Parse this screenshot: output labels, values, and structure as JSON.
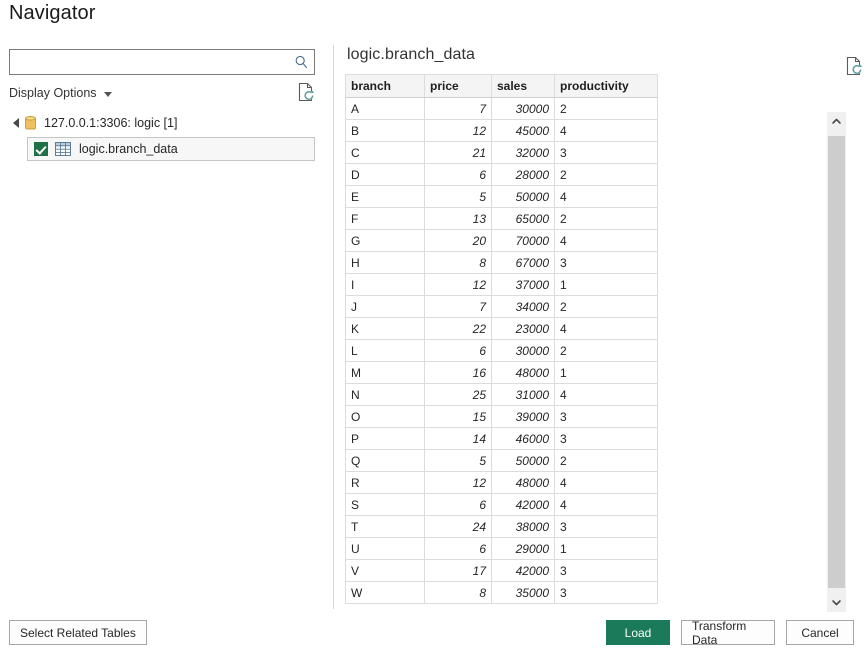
{
  "window": {
    "title": "Navigator"
  },
  "left_pane": {
    "search": {
      "value": "",
      "placeholder": "",
      "icon": "search-icon"
    },
    "display_options": {
      "label": "Display Options",
      "icon": "chevron-down-icon"
    },
    "refresh_icon": "refresh-document-icon",
    "tree": {
      "server": {
        "label": "127.0.0.1:3306: logic [1]",
        "icon": "database-icon",
        "expanded": true
      },
      "items": [
        {
          "label": "logic.branch_data",
          "checked": true,
          "selected": true,
          "icon": "table-icon"
        }
      ]
    }
  },
  "right_pane": {
    "preview_title": "logic.branch_data",
    "refresh_icon": "refresh-document-icon",
    "table": {
      "columns": [
        "branch",
        "price",
        "sales",
        "productivity"
      ],
      "column_align": [
        "left",
        "right",
        "right",
        "left"
      ],
      "rows": [
        [
          "A",
          "7",
          "30000",
          "2"
        ],
        [
          "B",
          "12",
          "45000",
          "4"
        ],
        [
          "C",
          "21",
          "32000",
          "3"
        ],
        [
          "D",
          "6",
          "28000",
          "2"
        ],
        [
          "E",
          "5",
          "50000",
          "4"
        ],
        [
          "F",
          "13",
          "65000",
          "2"
        ],
        [
          "G",
          "20",
          "70000",
          "4"
        ],
        [
          "H",
          "8",
          "67000",
          "3"
        ],
        [
          "I",
          "12",
          "37000",
          "1"
        ],
        [
          "J",
          "7",
          "34000",
          "2"
        ],
        [
          "K",
          "22",
          "23000",
          "4"
        ],
        [
          "L",
          "6",
          "30000",
          "2"
        ],
        [
          "M",
          "16",
          "48000",
          "1"
        ],
        [
          "N",
          "25",
          "31000",
          "4"
        ],
        [
          "O",
          "15",
          "39000",
          "3"
        ],
        [
          "P",
          "14",
          "46000",
          "3"
        ],
        [
          "Q",
          "5",
          "50000",
          "2"
        ],
        [
          "R",
          "12",
          "48000",
          "4"
        ],
        [
          "S",
          "6",
          "42000",
          "4"
        ],
        [
          "T",
          "24",
          "38000",
          "3"
        ],
        [
          "U",
          "6",
          "29000",
          "1"
        ],
        [
          "V",
          "17",
          "42000",
          "3"
        ],
        [
          "W",
          "8",
          "35000",
          "3"
        ]
      ]
    }
  },
  "scrollbar": {
    "up_icon": "chevron-up-icon",
    "down_icon": "chevron-down-icon"
  },
  "footer": {
    "select_related_tables": "Select Related Tables",
    "load": "Load",
    "transform_data": "Transform Data",
    "cancel": "Cancel"
  },
  "colors": {
    "accent_green": "#1a7a59",
    "checkbox_green": "#1e7145",
    "header_bg": "#f4f4f4",
    "grid_line": "#dcdcdc",
    "scrollbar_thumb": "#cdcdcd"
  }
}
